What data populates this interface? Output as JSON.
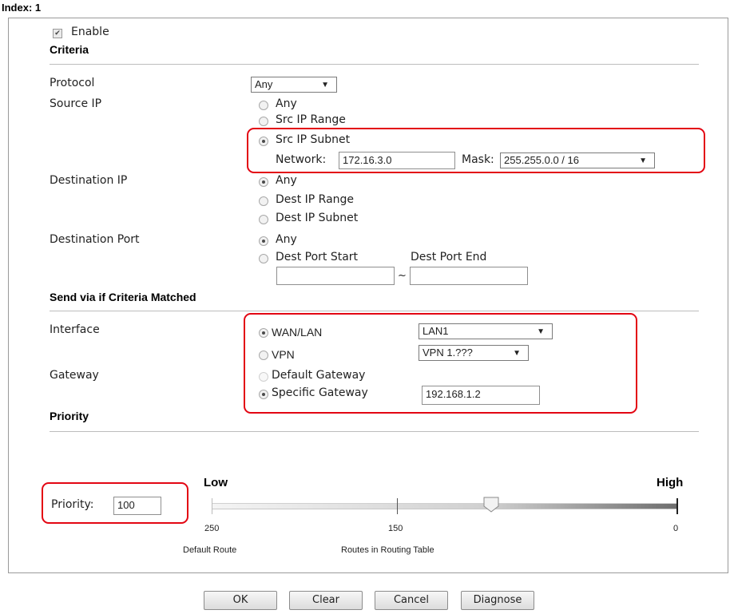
{
  "header": {
    "index_label": "Index: 1"
  },
  "enable": {
    "label": "Enable",
    "checked": true
  },
  "criteria": {
    "heading": "Criteria",
    "protocol": {
      "label": "Protocol",
      "value": "Any"
    },
    "source_ip": {
      "label": "Source IP",
      "options": [
        "Any",
        "Src IP Range",
        "Src IP Subnet"
      ],
      "selected": "Src IP Subnet",
      "network_label": "Network:",
      "network_value": "172.16.3.0",
      "mask_label": "Mask:",
      "mask_value": "255.255.0.0 / 16"
    },
    "destination_ip": {
      "label": "Destination IP",
      "options": [
        "Any",
        "Dest IP Range",
        "Dest IP Subnet"
      ],
      "selected": "Any"
    },
    "destination_port": {
      "label": "Destination Port",
      "options": [
        "Any",
        "Dest Port Start"
      ],
      "selected": "Any",
      "end_label": "Dest Port End",
      "range_sep": "~",
      "start_value": "",
      "end_value": ""
    }
  },
  "send_via": {
    "heading": "Send via if Criteria Matched",
    "interface": {
      "label": "Interface",
      "wan_lan_label": "WAN/LAN",
      "wan_lan_value": "LAN1",
      "vpn_label": "VPN",
      "vpn_value": "VPN 1.???",
      "selected": "WAN/LAN"
    },
    "gateway": {
      "label": "Gateway",
      "default_label": "Default Gateway",
      "specific_label": "Specific Gateway",
      "specific_value": "192.168.1.2",
      "selected": "Specific Gateway"
    }
  },
  "priority": {
    "heading": "Priority",
    "label": "Priority:",
    "value": "100",
    "slider_fraction": 0.6,
    "low_label": "Low",
    "high_label": "High",
    "tick_250": "250",
    "tick_150": "150",
    "tick_0": "0",
    "default_route": "Default Route",
    "routes_label": "Routes in Routing Table"
  },
  "buttons": {
    "ok": "OK",
    "clear": "Clear",
    "cancel": "Cancel",
    "diagnose": "Diagnose"
  },
  "colors": {
    "highlight": "#e30613",
    "border": "#9a9a9a"
  }
}
